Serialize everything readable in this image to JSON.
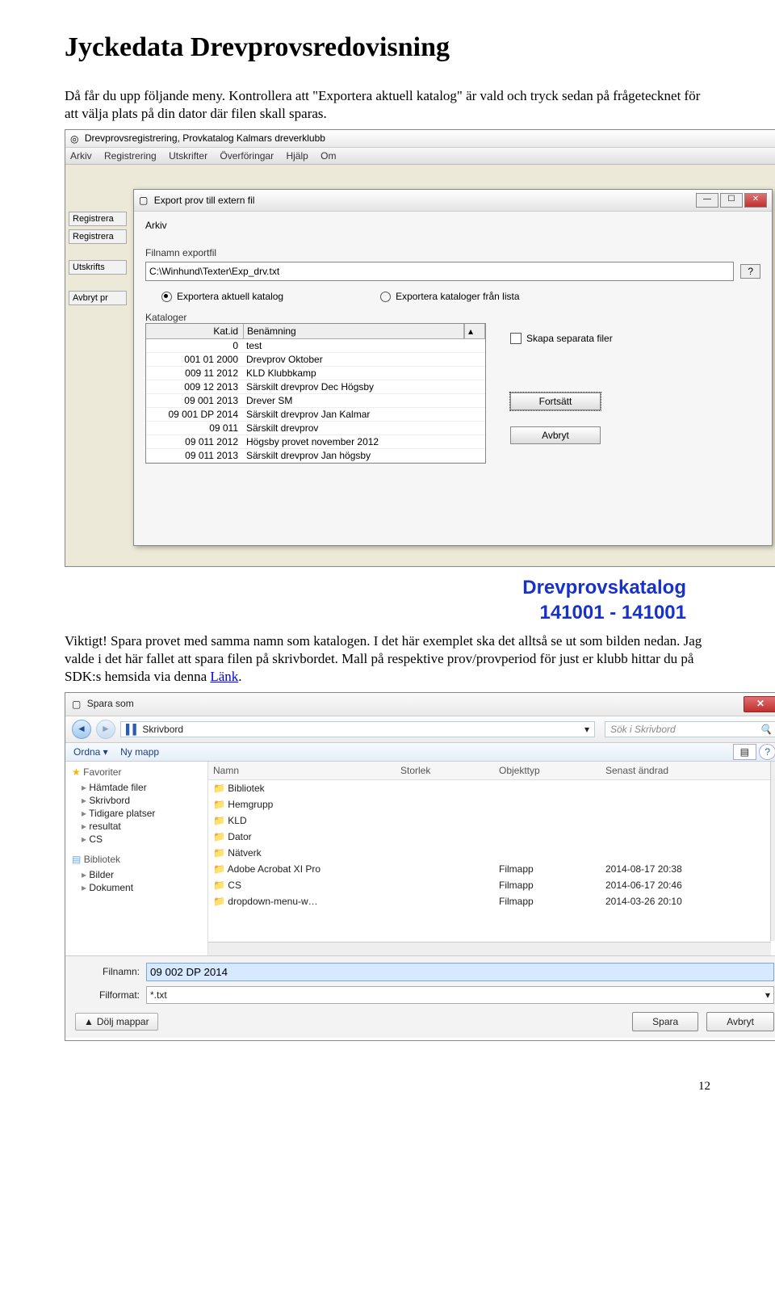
{
  "title": "Jyckedata Drevprovsredovisning",
  "para1_a": "Då får du upp följande meny. Kontrollera att \"Exportera aktuell katalog\" är vald och tryck sedan på frågetecknet för att välja plats på din dator där filen skall sparas.",
  "ss1": {
    "winTitle": "Drevprovsregistrering, Provkatalog  Kalmars dreverklubb",
    "menus": [
      "Arkiv",
      "Registrering",
      "Utskrifter",
      "Överföringar",
      "Hjälp",
      "Om"
    ],
    "sideBtns": [
      "Registrera",
      "Registrera",
      "Utskrifts",
      "Avbryt pr"
    ],
    "modalTitle": "Export prov till extern fil",
    "modalMenu": "Arkiv",
    "labelFil": "Filnamn exportfil",
    "filValue": "C:\\Winhund\\Texter\\Exp_drv.txt",
    "q": "?",
    "radio1": "Exportera aktuell katalog",
    "radio2": "Exportera kataloger från lista",
    "katLbl": "Kataloger",
    "th1": "Kat.id",
    "th2": "Benämning",
    "rows": [
      [
        "0",
        "test"
      ],
      [
        "001 01 2000",
        "Drevprov Oktober"
      ],
      [
        "009 11 2012",
        "KLD Klubbkamp"
      ],
      [
        "009 12 2013",
        "Särskilt drevprov Dec Högsby"
      ],
      [
        "09 001 2013",
        "Drever SM"
      ],
      [
        "09 001 DP 2014",
        "Särskilt drevprov Jan Kalmar"
      ],
      [
        "09 011",
        "Särskilt drevprov"
      ],
      [
        "09 011 2012",
        "Högsby provet november 2012"
      ],
      [
        "09 011 2013",
        "Särskilt drevprov Jan högsby"
      ]
    ],
    "chk": "Skapa separata filer",
    "btn1": "Fortsätt",
    "btn2": "Avbryt"
  },
  "blue1": "Drevprovskatalog",
  "blue2": "141001 - 141001",
  "para2_a": "Viktigt! Spara provet med samma namn som katalogen. I det här exemplet ska det alltså se ut som bilden nedan. Jag valde i det här fallet att spara filen på skrivbordet. Mall på respektive prov/provperiod för just er klubb hittar du på SDK:s hemsida via denna ",
  "link": "Länk",
  "para2_b": ".",
  "ss2": {
    "title": "Spara som",
    "crumb": "Skrivbord",
    "searchPH": "Sök i Skrivbord",
    "tb1": "Ordna ▾",
    "tb2": "Ny mapp",
    "side": {
      "g1": "Favoriter",
      "i1": [
        "Hämtade filer",
        "Skrivbord",
        "Tidigare platser",
        "resultat",
        "CS"
      ],
      "g2": "Bibliotek",
      "i2": [
        "Bilder",
        "Dokument"
      ]
    },
    "cols": [
      "Namn",
      "Storlek",
      "Objekttyp",
      "Senast ändrad"
    ],
    "rows": [
      {
        "n": "Bibliotek",
        "s": "",
        "t": "",
        "d": ""
      },
      {
        "n": "Hemgrupp",
        "s": "",
        "t": "",
        "d": ""
      },
      {
        "n": "KLD",
        "s": "",
        "t": "",
        "d": ""
      },
      {
        "n": "Dator",
        "s": "",
        "t": "",
        "d": ""
      },
      {
        "n": "Nätverk",
        "s": "",
        "t": "",
        "d": ""
      },
      {
        "n": "Adobe Acrobat XI Pro",
        "s": "",
        "t": "Filmapp",
        "d": "2014-08-17 20:38"
      },
      {
        "n": "CS",
        "s": "",
        "t": "Filmapp",
        "d": "2014-06-17 20:46"
      },
      {
        "n": "dropdown-menu-w…",
        "s": "",
        "t": "Filmapp",
        "d": "2014-03-26 20:10"
      }
    ],
    "fnLbl": "Filnamn:",
    "fnVal": "09 002 DP 2014",
    "ffLbl": "Filformat:",
    "ffVal": "*.txt",
    "hide": "Dölj mappar",
    "save": "Spara",
    "cancel": "Avbryt"
  },
  "pageNum": "12"
}
